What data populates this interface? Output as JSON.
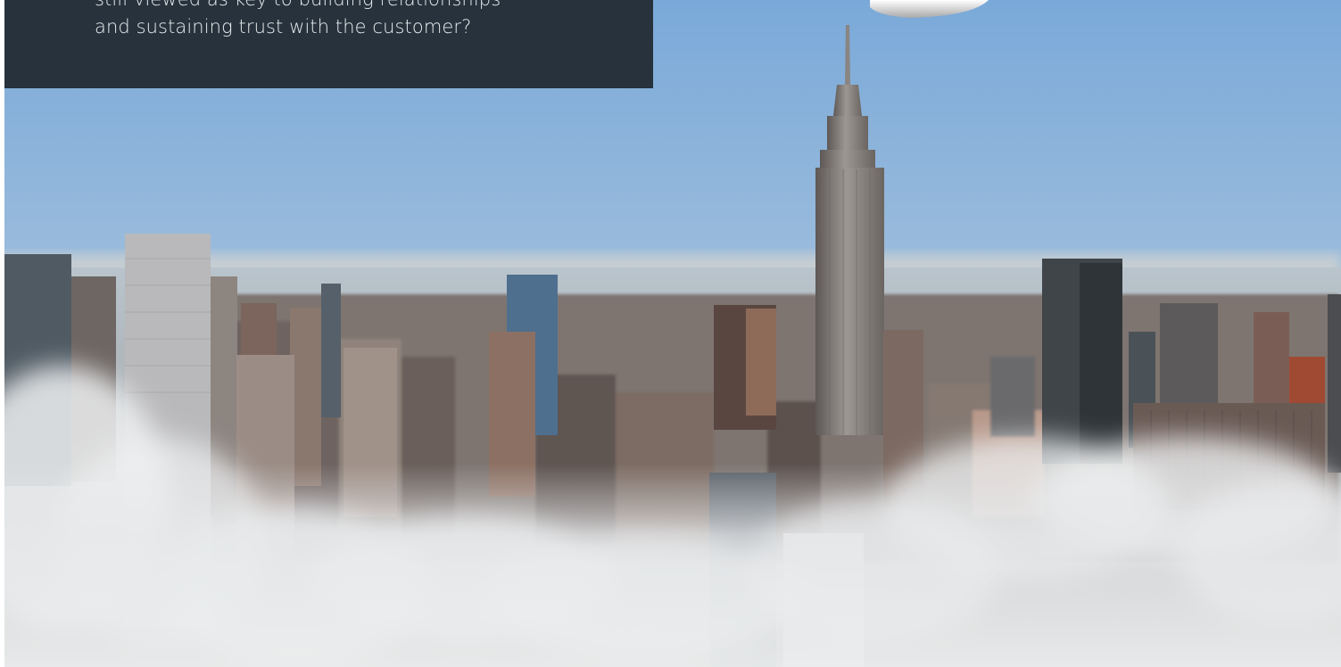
{
  "quote": {
    "line1": "still viewed as key to building relationships",
    "line2": "and sustaining trust with the customer?"
  },
  "colors": {
    "panel_bg": "#27323c",
    "panel_text": "#e7ecf0",
    "sky_top": "#7eaedc",
    "sky_horizon": "#cfdbe3",
    "fog": "#e4e7ea"
  }
}
